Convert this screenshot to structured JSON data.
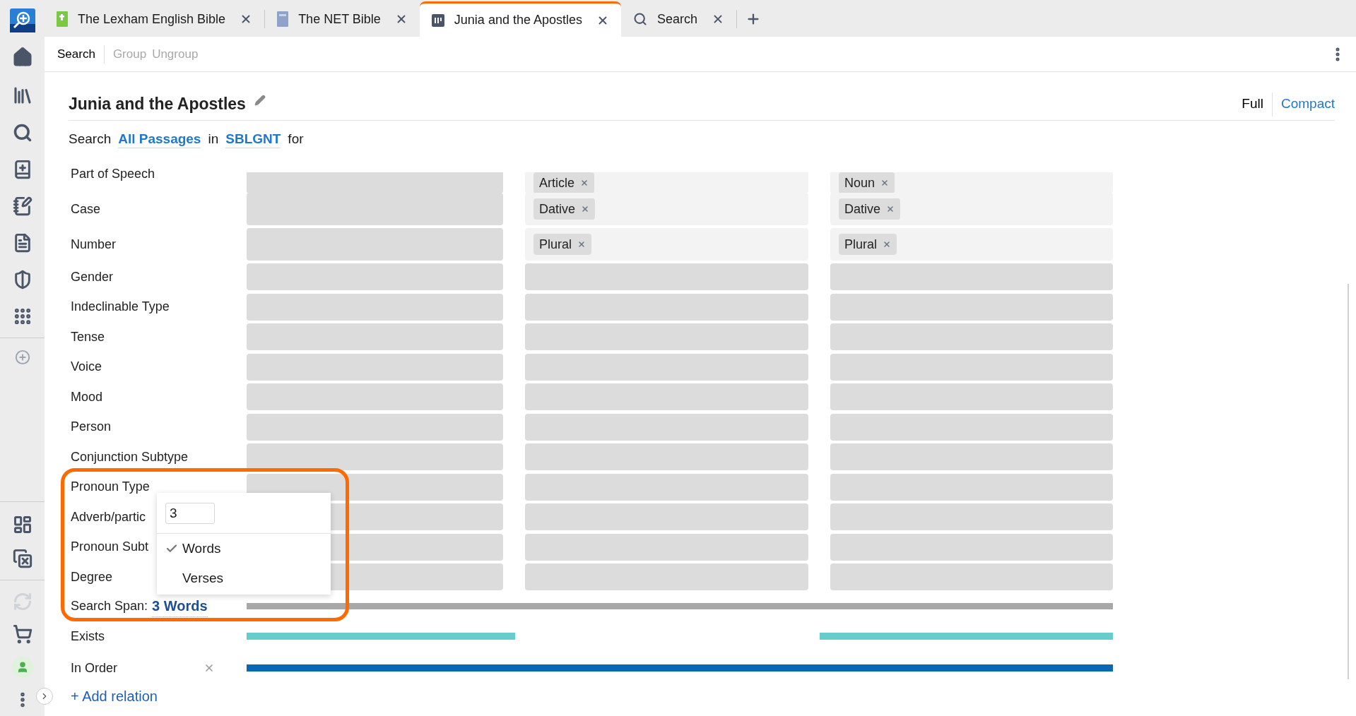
{
  "tabs": [
    {
      "label": "The Lexham English Bible",
      "kind": "bible",
      "selected": false
    },
    {
      "label": "The NET Bible",
      "kind": "book",
      "selected": false
    },
    {
      "label": "Junia and the Apostles",
      "kind": "document",
      "selected": true
    },
    {
      "label": "Search",
      "kind": "search",
      "selected": false
    }
  ],
  "toolbar": [
    {
      "label": "Search",
      "disabled": false
    },
    {
      "label": "Group",
      "disabled": true
    },
    {
      "label": "Ungroup",
      "disabled": true
    }
  ],
  "document": {
    "title": "Junia and the Apostles",
    "views": [
      {
        "label": "Full",
        "selected": true
      },
      {
        "label": "Compact",
        "selected": false
      }
    ],
    "search_line": [
      {
        "text": "Search",
        "kind": "text"
      },
      {
        "text": "All Passages",
        "kind": "link"
      },
      {
        "text": "in",
        "kind": "text"
      },
      {
        "text": "SBLGNT",
        "kind": "link"
      },
      {
        "text": "for",
        "kind": "text"
      }
    ]
  },
  "rows": [
    {
      "label": "Part of Speech",
      "cells": [
        {
          "kind": "empty"
        },
        {
          "kind": "tags",
          "tags": [
            "Article"
          ]
        },
        {
          "kind": "tags",
          "tags": [
            "Noun"
          ]
        }
      ]
    },
    {
      "label": "Case",
      "cells": [
        {
          "kind": "empty"
        },
        {
          "kind": "tags",
          "tags": [
            "Dative"
          ]
        },
        {
          "kind": "tags",
          "tags": [
            "Dative"
          ]
        }
      ]
    },
    {
      "label": "Number",
      "cells": [
        {
          "kind": "empty"
        },
        {
          "kind": "tags",
          "tags": [
            "Plural"
          ]
        },
        {
          "kind": "tags",
          "tags": [
            "Plural"
          ]
        }
      ]
    },
    {
      "label": "Gender",
      "cells": [
        {
          "kind": "empty"
        },
        {
          "kind": "empty"
        },
        {
          "kind": "empty"
        }
      ]
    },
    {
      "label": "Indeclinable Type",
      "cells": [
        {
          "kind": "empty"
        },
        {
          "kind": "empty"
        },
        {
          "kind": "empty"
        }
      ]
    },
    {
      "label": "Tense",
      "cells": [
        {
          "kind": "empty"
        },
        {
          "kind": "empty"
        },
        {
          "kind": "empty"
        }
      ]
    },
    {
      "label": "Voice",
      "cells": [
        {
          "kind": "empty"
        },
        {
          "kind": "empty"
        },
        {
          "kind": "empty"
        }
      ]
    },
    {
      "label": "Mood",
      "cells": [
        {
          "kind": "empty"
        },
        {
          "kind": "empty"
        },
        {
          "kind": "empty"
        }
      ]
    },
    {
      "label": "Person",
      "cells": [
        {
          "kind": "empty"
        },
        {
          "kind": "empty"
        },
        {
          "kind": "empty"
        }
      ]
    },
    {
      "label": "Conjunction Subtype",
      "cells": [
        {
          "kind": "empty"
        },
        {
          "kind": "empty"
        },
        {
          "kind": "empty"
        }
      ]
    },
    {
      "label": "Pronoun Type",
      "cells": [
        {
          "kind": "empty"
        },
        {
          "kind": "empty"
        },
        {
          "kind": "empty"
        }
      ]
    },
    {
      "label": "Adverb/partic",
      "cells": [
        {
          "kind": "empty"
        },
        {
          "kind": "empty"
        },
        {
          "kind": "empty"
        }
      ]
    },
    {
      "label": "Pronoun Subt",
      "cells": [
        {
          "kind": "empty"
        },
        {
          "kind": "empty"
        },
        {
          "kind": "empty"
        }
      ]
    },
    {
      "label": "Degree",
      "cells": [
        {
          "kind": "empty"
        },
        {
          "kind": "empty"
        },
        {
          "kind": "empty"
        }
      ]
    }
  ],
  "span": {
    "label": "Search Span:",
    "value": "3 Words"
  },
  "relations": [
    {
      "label": "Exists",
      "kind": "exists",
      "removable": false
    },
    {
      "label": "In Order",
      "kind": "order",
      "removable": true
    }
  ],
  "add_relation": "+ Add relation",
  "span_popup": {
    "value": "3",
    "options": [
      {
        "label": "Words",
        "selected": true
      },
      {
        "label": "Verses",
        "selected": false
      }
    ]
  }
}
